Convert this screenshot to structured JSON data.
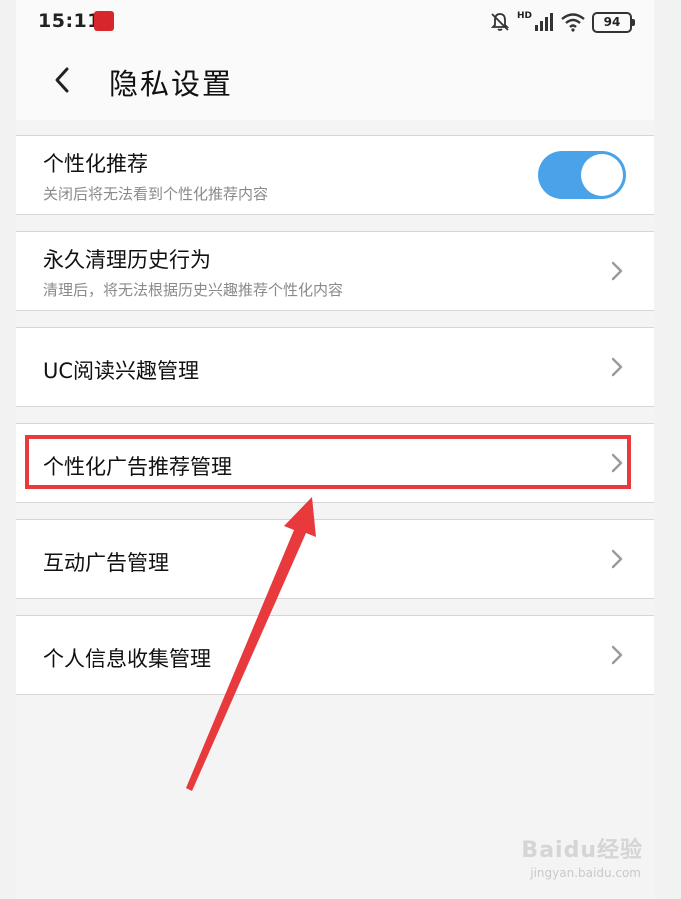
{
  "status_bar": {
    "time": "15:11",
    "network": "HD",
    "battery": "94"
  },
  "header": {
    "title": "隐私设置"
  },
  "settings": [
    {
      "title": "个性化推荐",
      "subtitle": "关闭后将无法看到个性化推荐内容",
      "control": "toggle",
      "toggle_on": true
    },
    {
      "title": "永久清理历史行为",
      "subtitle": "清理后，将无法根据历史兴趣推荐个性化内容",
      "control": "chevron"
    },
    {
      "title": "UC阅读兴趣管理",
      "control": "chevron"
    },
    {
      "title": "个性化广告推荐管理",
      "control": "chevron",
      "highlighted": true
    },
    {
      "title": "互动广告管理",
      "control": "chevron"
    },
    {
      "title": "个人信息收集管理",
      "control": "chevron"
    }
  ],
  "annotation": {
    "highlight_color": "#e8393d",
    "arrow_color": "#e8393d"
  },
  "watermark": {
    "brand": "Baidu经验",
    "url": "jingyan.baidu.com"
  },
  "colors": {
    "toggle_on": "#4aa3e8",
    "background": "#f4f4f4"
  }
}
